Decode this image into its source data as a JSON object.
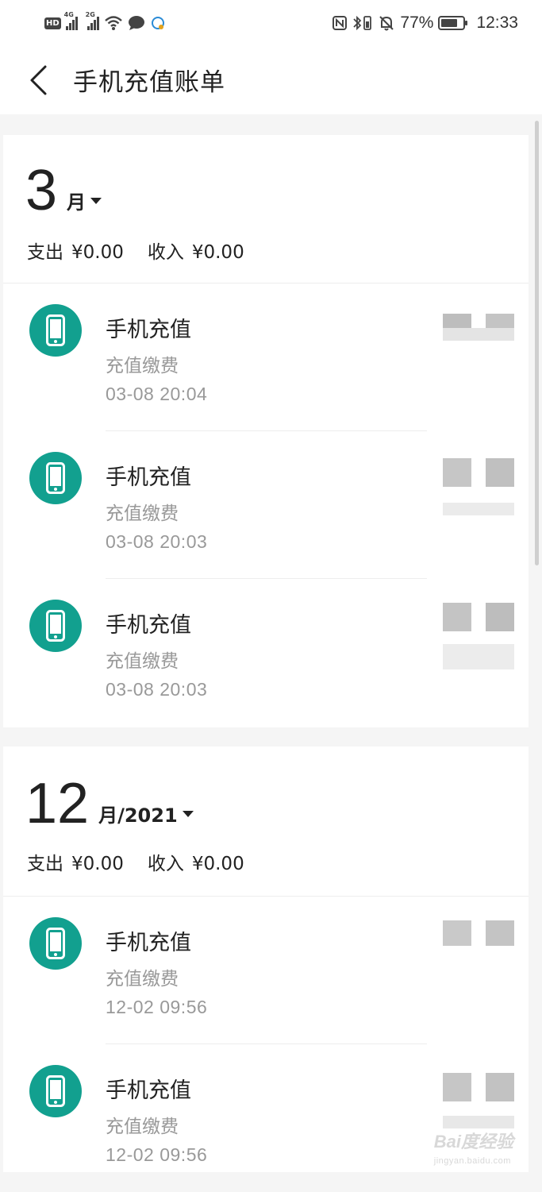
{
  "status_bar": {
    "hd_label": "HD",
    "net1": "4G",
    "net2": "2G",
    "battery_pct": "77%",
    "time": "12:33"
  },
  "header": {
    "title": "手机充值账单"
  },
  "months": [
    {
      "month": "3",
      "suffix": "月",
      "summary": {
        "expense_label": "支出",
        "expense": "¥0.00",
        "income_label": "收入",
        "income": "¥0.00"
      },
      "items": [
        {
          "name": "手机充值",
          "category": "充值缴费",
          "time": "03-08  20:04"
        },
        {
          "name": "手机充值",
          "category": "充值缴费",
          "time": "03-08  20:03"
        },
        {
          "name": "手机充值",
          "category": "充值缴费",
          "time": "03-08  20:03"
        }
      ]
    },
    {
      "month": "12",
      "suffix": "月/2021",
      "summary": {
        "expense_label": "支出",
        "expense": "¥0.00",
        "income_label": "收入",
        "income": "¥0.00"
      },
      "items": [
        {
          "name": "手机充值",
          "category": "充值缴费",
          "time": "12-02  09:56"
        },
        {
          "name": "手机充值",
          "category": "充值缴费",
          "time": "12-02  09:56"
        }
      ]
    }
  ],
  "watermark": {
    "brand": "Bai度经验",
    "url": "jingyan.baidu.com"
  },
  "colors": {
    "accent": "#12a08f",
    "muted_text": "#999999",
    "background": "#f5f5f5"
  }
}
